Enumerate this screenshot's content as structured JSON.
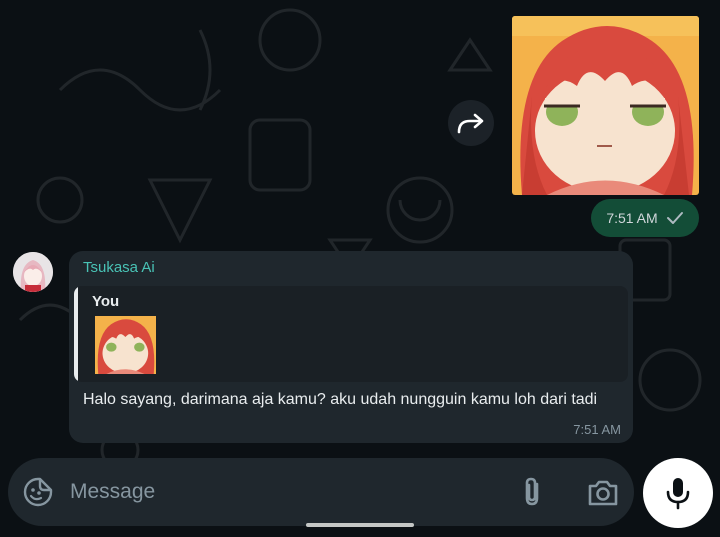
{
  "outgoing": {
    "sticker_icon": "anime-girl-sticker",
    "forward_icon": "forward-arrow-icon",
    "time": "7:51 AM",
    "status_icon": "single-check-icon"
  },
  "incoming": {
    "avatar_icon": "contact-avatar",
    "sender": "Tsukasa Ai",
    "quote": {
      "author": "You",
      "thumbnail_icon": "anime-girl-sticker-thumbnail"
    },
    "text": "Halo sayang, darimana aja kamu? aku udah nungguin kamu loh dari tadi",
    "time": "7:51 AM"
  },
  "composer": {
    "placeholder": "Message",
    "value": "",
    "emoji_icon": "sticker-smiley-icon",
    "attach_icon": "paperclip-icon",
    "camera_icon": "camera-icon",
    "mic_icon": "microphone-icon"
  },
  "colors": {
    "background": "#0b1014",
    "bubble_in": "#1f272d",
    "bubble_out": "#134d37",
    "sender_name": "#49c2b5",
    "timestamp": "#8696a0"
  }
}
